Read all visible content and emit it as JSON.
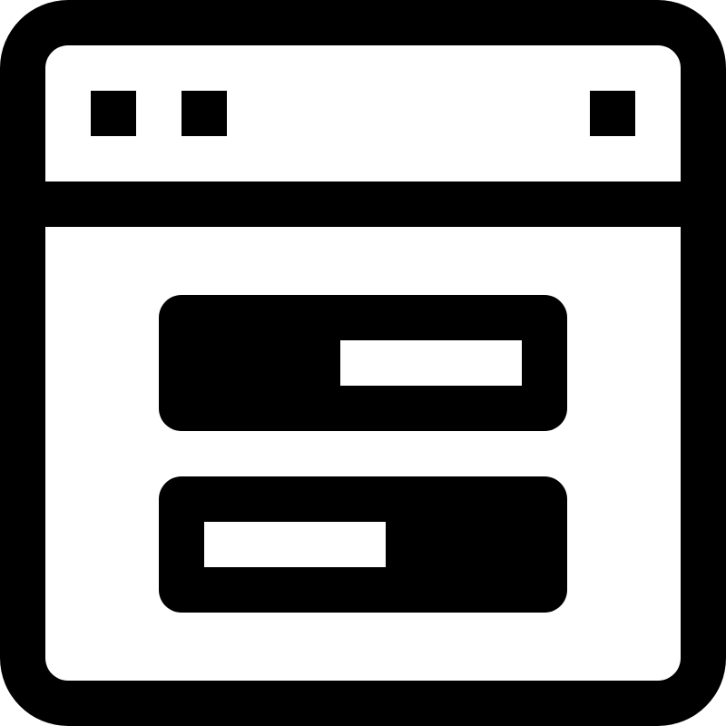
{
  "icon": {
    "name": "browser-window-toggles-icon",
    "foreground": "#000000",
    "background": "#ffffff"
  },
  "titlebar": {
    "left_buttons": [
      "window-control-square-icon",
      "window-control-square-icon"
    ],
    "right_buttons": [
      "window-control-square-icon"
    ]
  },
  "toggles": [
    {
      "name": "toggle-switch",
      "state": "on",
      "knob_position": "right"
    },
    {
      "name": "toggle-switch",
      "state": "off",
      "knob_position": "left"
    }
  ]
}
